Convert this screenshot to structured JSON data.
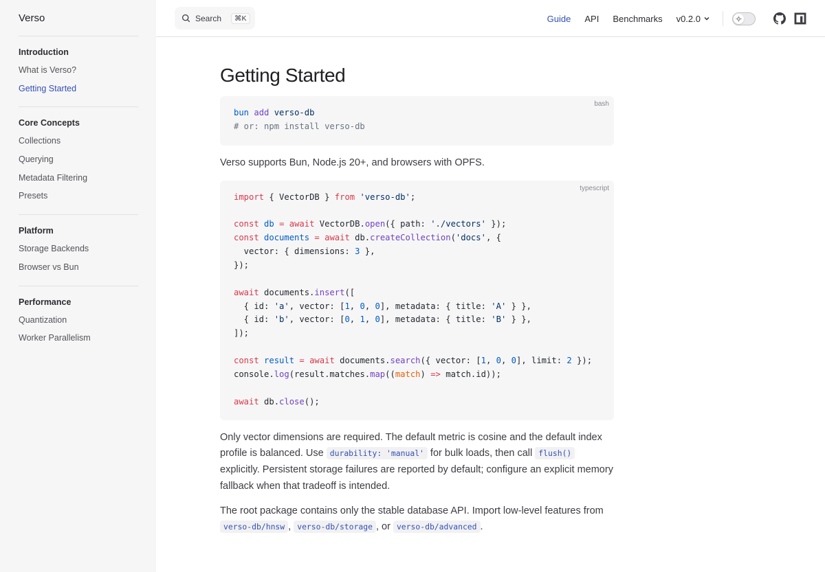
{
  "app": {
    "logo": "Verso"
  },
  "search": {
    "label": "Search",
    "shortcut": "⌘K"
  },
  "topnav": {
    "links": [
      "Guide",
      "API",
      "Benchmarks"
    ],
    "active": "Guide",
    "version": "v0.2.0"
  },
  "sidebar": {
    "groups": [
      {
        "title": "Introduction",
        "items": [
          "What is Verso?",
          "Getting Started"
        ]
      },
      {
        "title": "Core Concepts",
        "items": [
          "Collections",
          "Querying",
          "Metadata Filtering",
          "Presets"
        ]
      },
      {
        "title": "Platform",
        "items": [
          "Storage Backends",
          "Browser vs Bun"
        ]
      },
      {
        "title": "Performance",
        "items": [
          "Quantization",
          "Worker Parallelism"
        ]
      }
    ],
    "active_item": "Getting Started"
  },
  "page": {
    "title": "Getting Started",
    "code1": {
      "lang": "bash",
      "lines": [
        "bun add verso-db",
        "# or: npm install verso-db"
      ]
    },
    "para1": "Verso supports Bun, Node.js 20+, and browsers with OPFS.",
    "code2": {
      "lang": "typescript",
      "lines": [
        "import { VectorDB } from 'verso-db';",
        "",
        "const db = await VectorDB.open({ path: './vectors' });",
        "const documents = await db.createCollection('docs', {",
        "  vector: { dimensions: 3 },",
        "});",
        "",
        "await documents.insert([",
        "  { id: 'a', vector: [1, 0, 0], metadata: { title: 'A' } },",
        "  { id: 'b', vector: [0, 1, 0], metadata: { title: 'B' } },",
        "]);",
        "",
        "const result = await documents.search({ vector: [1, 0, 0], limit: 2 });",
        "console.log(result.matches.map((match) => match.id));",
        "",
        "await db.close();"
      ]
    },
    "para2": {
      "t1": "Only vector dimensions are required. The default metric is cosine and the default index profile is balanced. Use ",
      "c1": "durability: 'manual'",
      "t2": " for bulk loads, then call ",
      "c2": "flush()",
      "t3": " explicitly. Persistent storage failures are reported by default; configure an explicit memory fallback when that tradeoff is intended."
    },
    "para3": {
      "t1": "The root package contains only the stable database API. Import low-level features from ",
      "c1": "verso-db/hnsw",
      "t2": ", ",
      "c2": "verso-db/storage",
      "t3": ", or ",
      "c3": "verso-db/advanced",
      "t4": "."
    }
  }
}
